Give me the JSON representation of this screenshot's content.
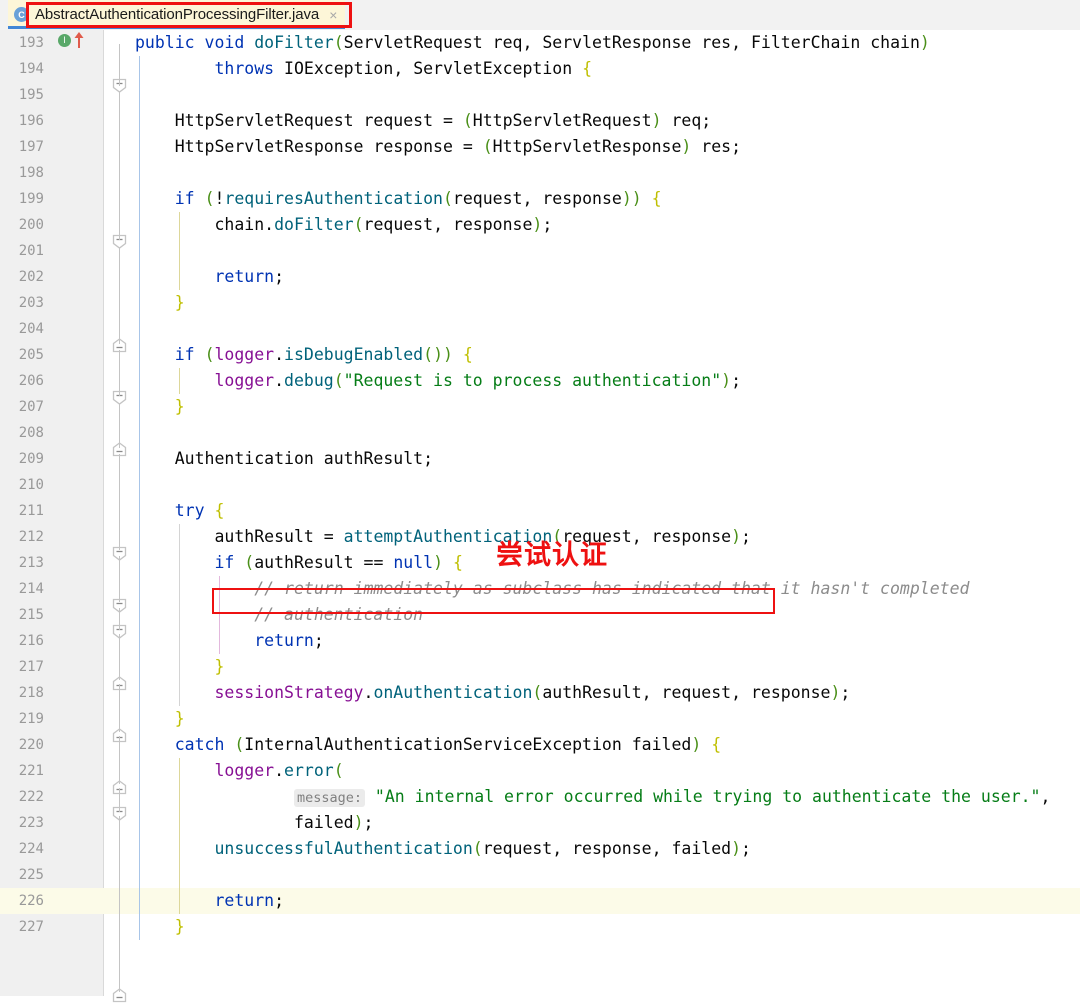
{
  "tab": {
    "icon": "java-class-icon",
    "label": "AbstractAuthenticationProcessingFilter.java",
    "close": "×"
  },
  "annotation": {
    "text": "尝试认证",
    "color": "#ee1111"
  },
  "gutter": {
    "run_marker": "I",
    "override_arrow": "override-up-arrow"
  },
  "colors": {
    "keyword": "#0033b3",
    "string": "#067d17",
    "comment": "#8c8c8c",
    "field": "#871094",
    "method": "#00627a",
    "brace": "#bfbf00",
    "paren": "#4a8f18",
    "highlight_line_bg": "#fcfbe8",
    "tab_bg": "#fdf6d8",
    "annotation_red": "#ee1111"
  },
  "editor": {
    "current_line": 226,
    "first_line": 193,
    "last_line": 227,
    "lines": [
      {
        "n": 193,
        "text": "public void doFilter(ServletRequest req, ServletResponse res, FilterChain chain)"
      },
      {
        "n": 194,
        "text": "        throws IOException, ServletException {"
      },
      {
        "n": 195,
        "text": ""
      },
      {
        "n": 196,
        "text": "    HttpServletRequest request = (HttpServletRequest) req;"
      },
      {
        "n": 197,
        "text": "    HttpServletResponse response = (HttpServletResponse) res;"
      },
      {
        "n": 198,
        "text": ""
      },
      {
        "n": 199,
        "text": "    if (!requiresAuthentication(request, response)) {"
      },
      {
        "n": 200,
        "text": "        chain.doFilter(request, response);"
      },
      {
        "n": 201,
        "text": ""
      },
      {
        "n": 202,
        "text": "        return;"
      },
      {
        "n": 203,
        "text": "    }"
      },
      {
        "n": 204,
        "text": ""
      },
      {
        "n": 205,
        "text": "    if (logger.isDebugEnabled()) {"
      },
      {
        "n": 206,
        "text": "        logger.debug(\"Request is to process authentication\");"
      },
      {
        "n": 207,
        "text": "    }"
      },
      {
        "n": 208,
        "text": ""
      },
      {
        "n": 209,
        "text": "    Authentication authResult;"
      },
      {
        "n": 210,
        "text": ""
      },
      {
        "n": 211,
        "text": "    try {"
      },
      {
        "n": 212,
        "text": "        authResult = attemptAuthentication(request, response);"
      },
      {
        "n": 213,
        "text": "        if (authResult == null) {"
      },
      {
        "n": 214,
        "text": "            // return immediately as subclass has indicated that it hasn't completed"
      },
      {
        "n": 215,
        "text": "            // authentication"
      },
      {
        "n": 216,
        "text": "            return;"
      },
      {
        "n": 217,
        "text": "        }"
      },
      {
        "n": 218,
        "text": "        sessionStrategy.onAuthentication(authResult, request, response);"
      },
      {
        "n": 219,
        "text": "    }"
      },
      {
        "n": 220,
        "text": "    catch (InternalAuthenticationServiceException failed) {"
      },
      {
        "n": 221,
        "text": "        logger.error("
      },
      {
        "n": 222,
        "text": "                message: \"An internal error occurred while trying to authenticate the user.\","
      },
      {
        "n": 223,
        "text": "                failed);"
      },
      {
        "n": 224,
        "text": "        unsuccessfulAuthentication(request, response, failed);"
      },
      {
        "n": 225,
        "text": ""
      },
      {
        "n": 226,
        "text": "        return;"
      },
      {
        "n": 227,
        "text": "    }"
      }
    ]
  }
}
